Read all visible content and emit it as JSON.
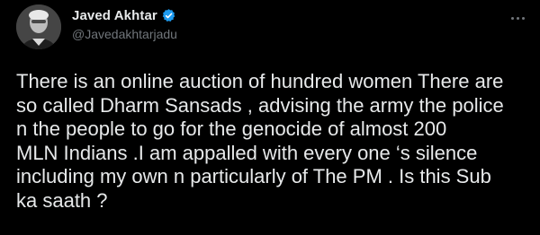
{
  "tweet": {
    "author": {
      "display_name": "Javed Akhtar",
      "handle": "@Javedakhtarjadu",
      "verified": true,
      "avatar_icon": "profile-photo"
    },
    "text_lines": [
      "There is an online auction of hundred women There are",
      "so called Dharm Sansads , advising the army the police",
      "n the people to go for the  genocide of almost 200",
      "MLN Indians .I am appalled with every one ‘s silence",
      "including my own n particularly of The PM . Is this Sub",
      "ka saath ?"
    ],
    "more_icon": "more-options-icon"
  },
  "colors": {
    "background": "#000000",
    "text": "#e7e9ea",
    "secondary_text": "#71767b",
    "verified_badge": "#1d9bf0"
  }
}
